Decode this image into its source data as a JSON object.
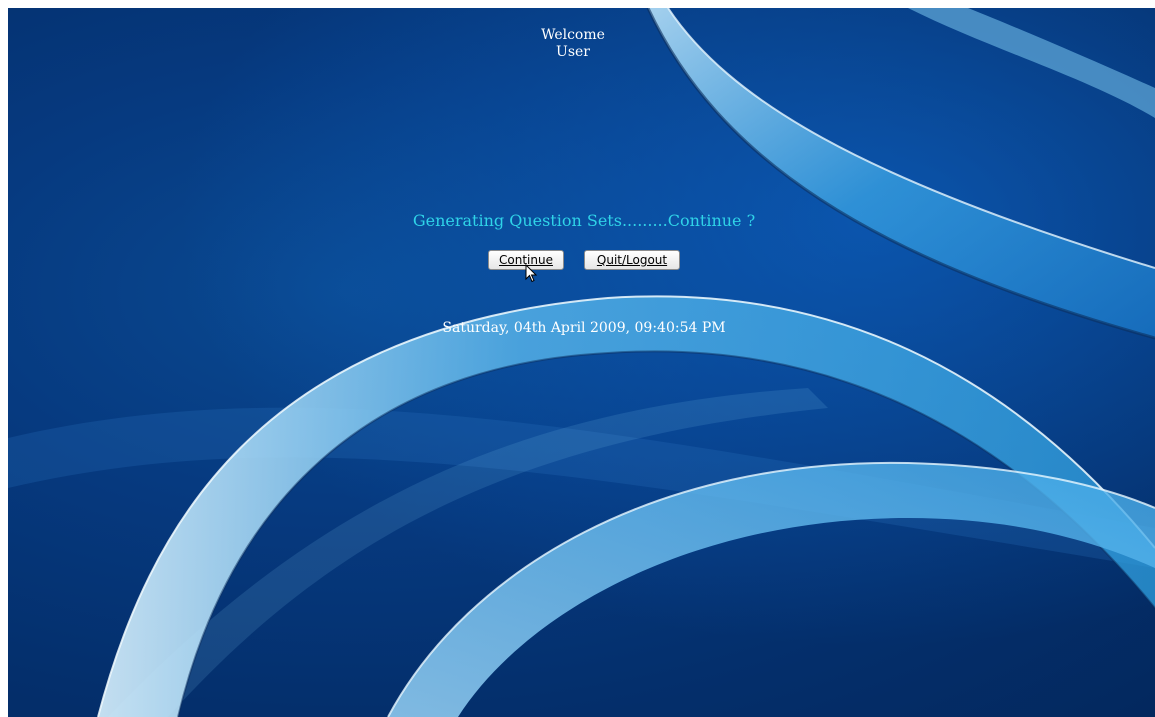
{
  "welcome": {
    "line1": "Welcome",
    "line2": "User"
  },
  "prompt_text": "Generating Question Sets.........Continue ?",
  "buttons": {
    "continue_label": "Continue",
    "quit_label": "Quit/Logout"
  },
  "datetime_text": "Saturday, 04th April 2009, 09:40:54 PM",
  "icons": {
    "cursor": "mouse-pointer-icon"
  },
  "colors": {
    "background": "#063a80",
    "prompt": "#2fd3e8",
    "text": "#ffffff",
    "ribbon": "#4fb4e8"
  }
}
